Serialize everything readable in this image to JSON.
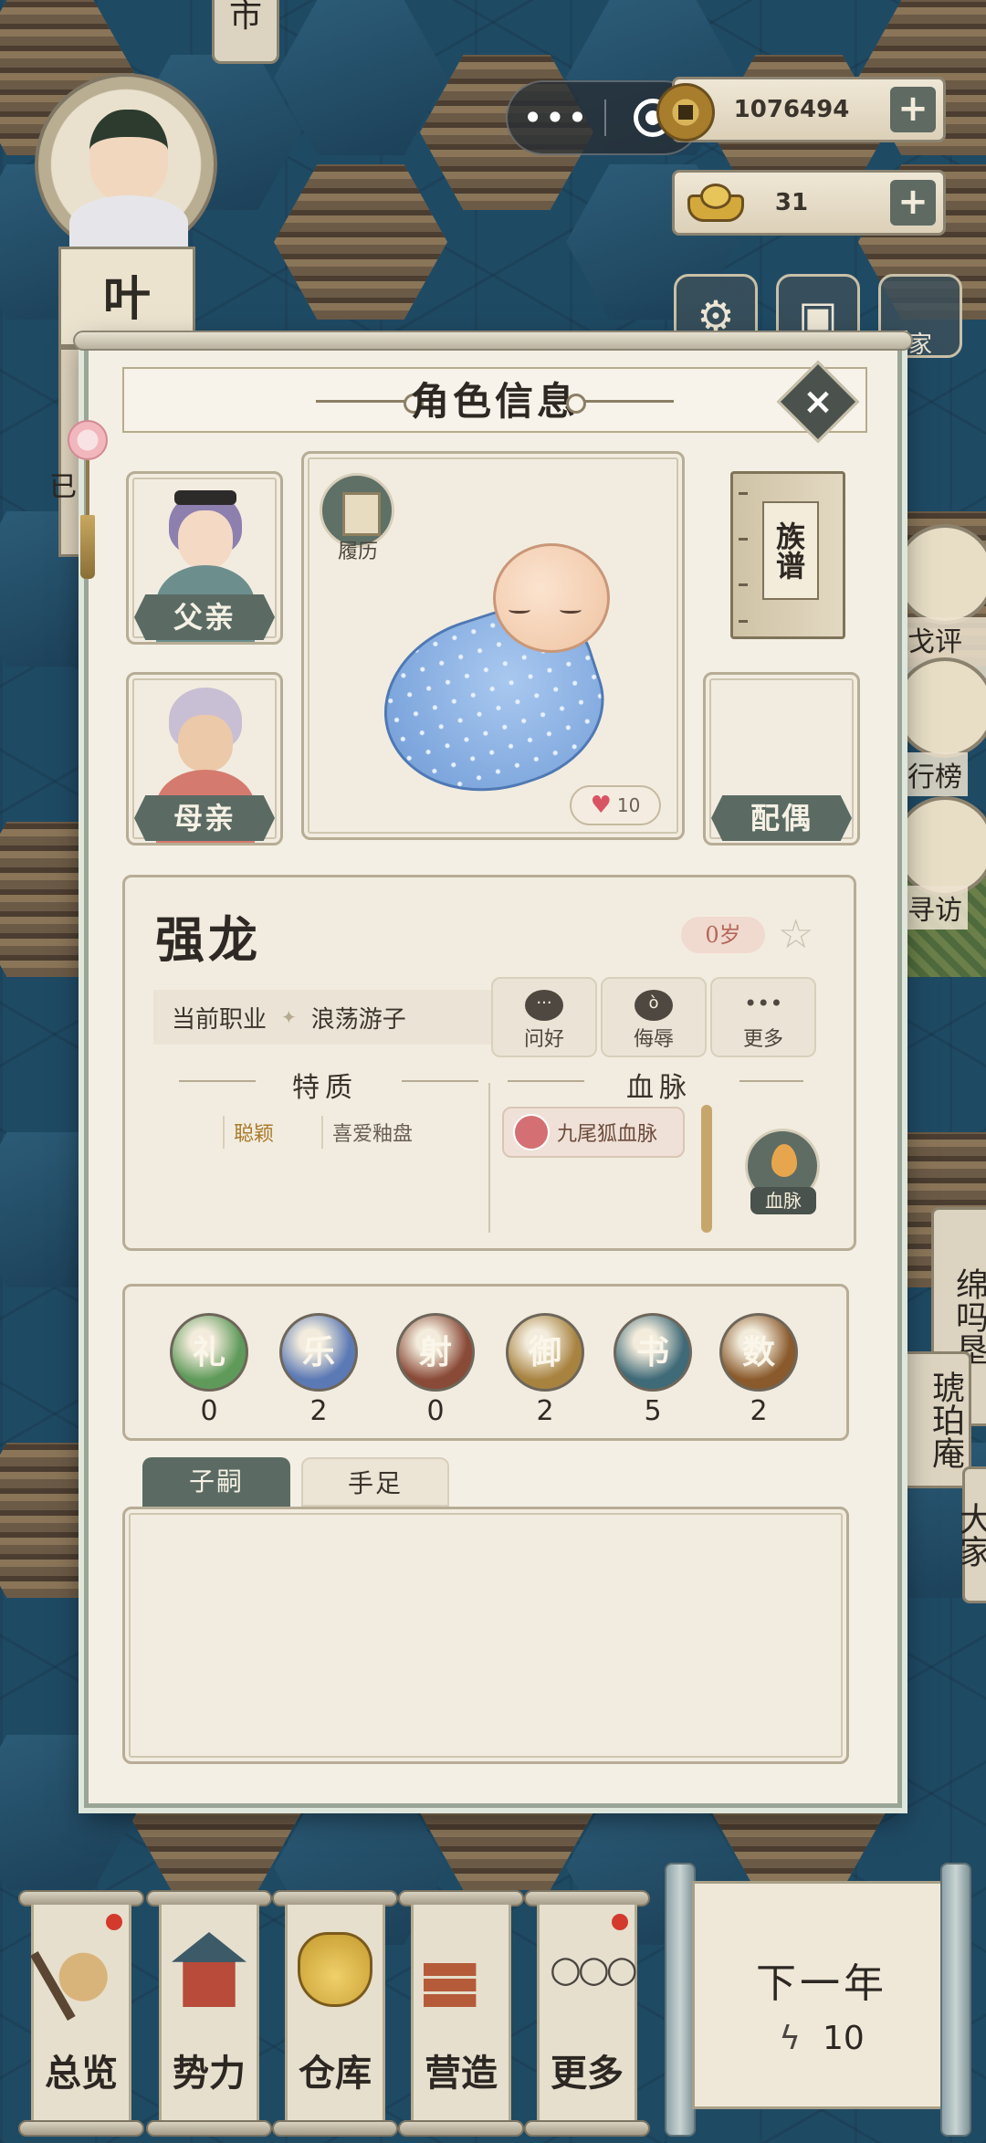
{
  "hud": {
    "coins": "1076494",
    "ingots": "31",
    "plus": "+",
    "capsule_dots": "•••",
    "partial_top_label": "市",
    "partial_right_label": "家"
  },
  "player": {
    "surname": "叶",
    "partial_left_label": "已"
  },
  "side": {
    "review_label": "戈评价",
    "rank_label": "行榜",
    "visit_label": "寻访",
    "plaque_amber": "琥珀庵",
    "plaque_partial_1": "绵吗垦",
    "plaque_partial_2": "大家"
  },
  "dialog": {
    "title": "角色信息",
    "close": "×",
    "father_label": "父亲",
    "mother_label": "母亲",
    "spouse_label": "配偶",
    "resume_label": "履历",
    "genealogy_label": "族谱",
    "affection": "10",
    "name": "强龙",
    "age": "0岁",
    "star": "☆",
    "job_key": "当前职业",
    "job_sep": "✦",
    "job_value": "浪荡游子",
    "actions": [
      {
        "label": "问好",
        "icon": "speech-bubble-icon",
        "glyph": "···"
      },
      {
        "label": "侮辱",
        "icon": "angry-face-icon",
        "glyph": "ò"
      },
      {
        "label": "更多",
        "icon": "more-dots-icon",
        "glyph": "•••"
      }
    ],
    "traits_header": "特质",
    "traits": [
      "聪颖",
      "喜爱釉盘"
    ],
    "bloodline_header": "血脉",
    "bloodline_chip": "九尾狐血脉",
    "bloodline_button": "血脉",
    "arts": [
      {
        "name": "礼",
        "value": "0",
        "color": "#5f9a5a"
      },
      {
        "name": "乐",
        "value": "2",
        "color": "#5b79b5"
      },
      {
        "name": "射",
        "value": "0",
        "color": "#8a4a38"
      },
      {
        "name": "御",
        "value": "2",
        "color": "#a88340"
      },
      {
        "name": "书",
        "value": "5",
        "color": "#3f6a78"
      },
      {
        "name": "数",
        "value": "2",
        "color": "#8a5a2c"
      }
    ],
    "tabs": [
      "子嗣",
      "手足"
    ]
  },
  "bottom": {
    "items": [
      {
        "label": "总览",
        "icon": "brush-icon",
        "badge": true
      },
      {
        "label": "势力",
        "icon": "pavilion-icon",
        "badge": false
      },
      {
        "label": "仓库",
        "icon": "money-bag-icon",
        "badge": false
      },
      {
        "label": "营造",
        "icon": "trowel-bricks-icon",
        "badge": false
      },
      {
        "label": "更多",
        "icon": "more-circles-icon",
        "badge": true
      }
    ],
    "next_year": "下一年",
    "energy": "10"
  }
}
